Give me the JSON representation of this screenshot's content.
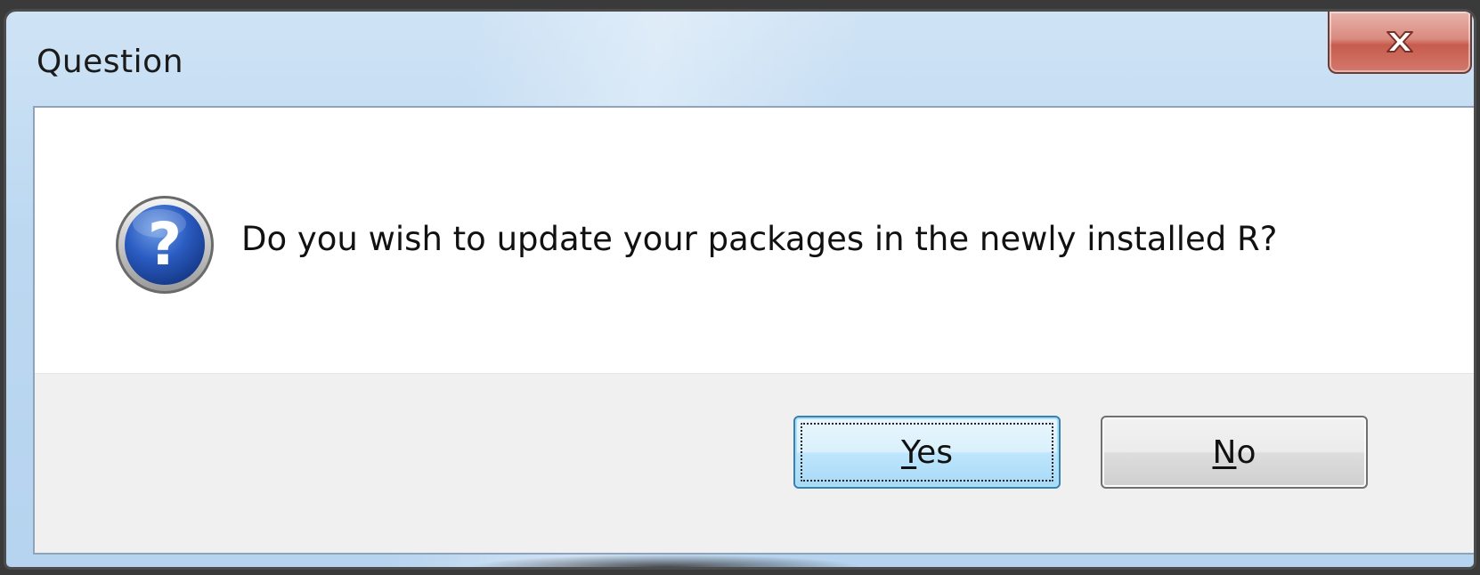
{
  "window": {
    "title": "Question"
  },
  "titlebar": {
    "close_icon": "close-icon"
  },
  "dialog": {
    "icon": "question-icon",
    "message": "Do you wish to update your packages in the newly installed R?"
  },
  "buttons": {
    "yes": {
      "mnemonic": "Y",
      "rest": "es"
    },
    "no": {
      "mnemonic": "N",
      "rest": "o"
    }
  },
  "colors": {
    "close_button": "#c75c4e",
    "question_icon": "#1f4fa8",
    "default_button_border": "#3c7fb1"
  }
}
